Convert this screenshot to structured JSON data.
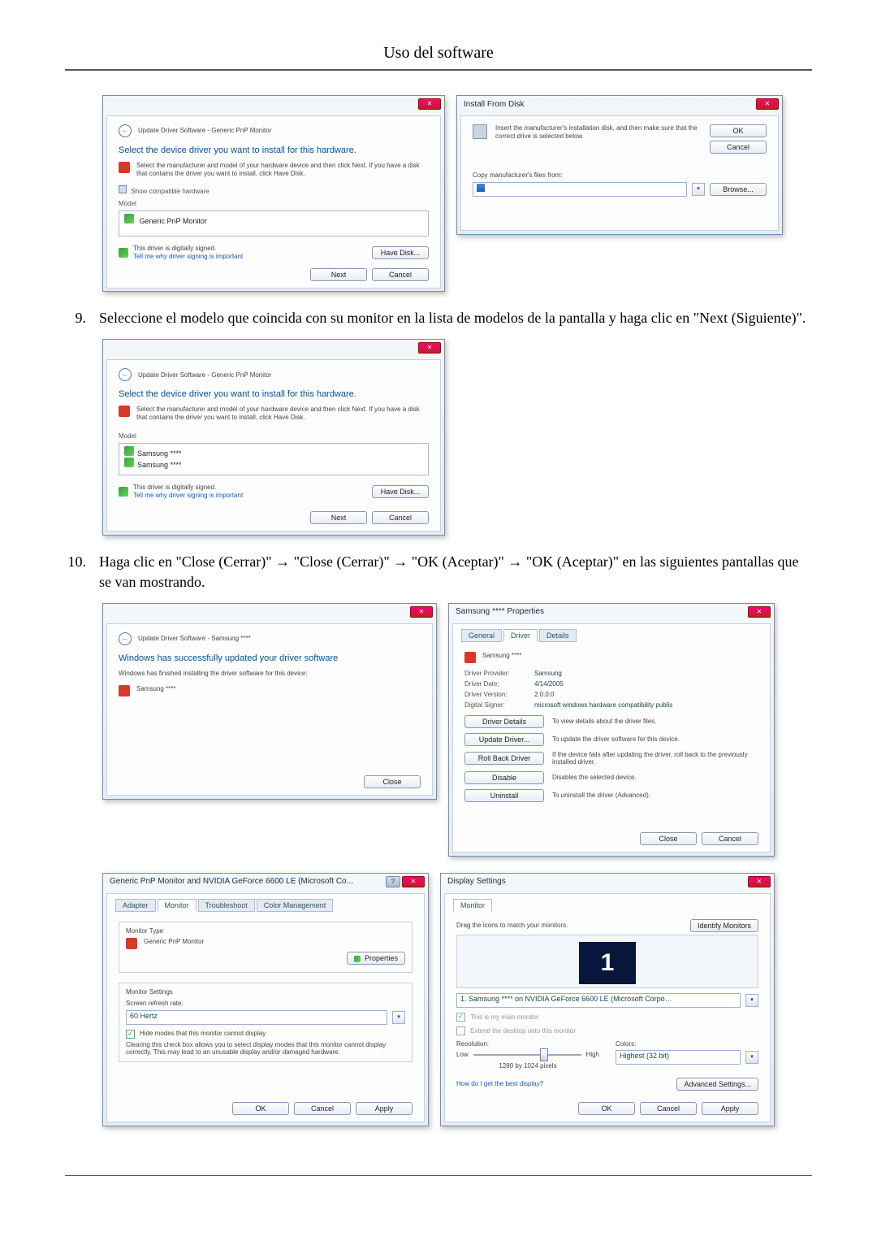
{
  "page": {
    "header": "Uso del software"
  },
  "step9": {
    "num": "9.",
    "text": "Seleccione el modelo que coincida con su monitor en la lista de modelos de la pantalla y haga clic en \"Next (Siguiente)\"."
  },
  "step10": {
    "num": "10.",
    "text": "Haga clic en \"Close (Cerrar)\" → \"Close (Cerrar)\" → \"OK (Aceptar)\" → \"OK (Aceptar)\" en las siguientes pantallas que se van mostrando."
  },
  "win_update1": {
    "title": "Update Driver Software - Generic PnP Monitor",
    "heading": "Select the device driver you want to install for this hardware.",
    "note": "Select the manufacturer and model of your hardware device and then click Next. If you have a disk that contains the driver you want to install, click Have Disk.",
    "show_compat": "Show compatible hardware",
    "model_label": "Model",
    "model_item": "Generic PnP Monitor",
    "signed": "This driver is digitally signed.",
    "tell_me": "Tell me why driver signing is important",
    "have_disk": "Have Disk...",
    "next": "Next",
    "cancel": "Cancel"
  },
  "win_install": {
    "title": "Install From Disk",
    "text": "Insert the manufacturer's installation disk, and then make sure that the correct drive is selected below.",
    "copy_label": "Copy manufacturer's files from:",
    "ok": "OK",
    "cancel": "Cancel",
    "browse": "Browse..."
  },
  "win_update2": {
    "title": "Update Driver Software - Generic PnP Monitor",
    "heading": "Select the device driver you want to install for this hardware.",
    "note": "Select the manufacturer and model of your hardware device and then click Next. If you have a disk that contains the driver you want to install, click Have Disk.",
    "model_label": "Model",
    "model_item_a": "Samsung ****",
    "model_item_b": "Samsung ****",
    "signed": "This driver is digitally signed.",
    "tell_me": "Tell me why driver signing is important",
    "have_disk": "Have Disk...",
    "next": "Next",
    "cancel": "Cancel"
  },
  "win_done": {
    "title": "Update Driver Software - Samsung ****",
    "heading": "Windows has successfully updated your driver software",
    "note": "Windows has finished installing the driver software for this device:",
    "device": "Samsung ****",
    "close": "Close"
  },
  "win_props": {
    "title": "Samsung **** Properties",
    "tab_general": "General",
    "tab_driver": "Driver",
    "tab_details": "Details",
    "device": "Samsung ****",
    "provider_k": "Driver Provider:",
    "provider_v": "Samsung",
    "date_k": "Driver Date:",
    "date_v": "4/14/2005",
    "version_k": "Driver Version:",
    "version_v": "2.0.0.0",
    "signer_k": "Digital Signer:",
    "signer_v": "microsoft windows hardware compatibility publis",
    "btn_details": "Driver Details",
    "btn_details_txt": "To view details about the driver files.",
    "btn_update": "Update Driver...",
    "btn_update_txt": "To update the driver software for this device.",
    "btn_roll": "Roll Back Driver",
    "btn_roll_txt": "If the device fails after updating the driver, roll back to the previously installed driver.",
    "btn_disable": "Disable",
    "btn_disable_txt": "Disables the selected device.",
    "btn_uninst": "Uninstall",
    "btn_uninst_txt": "To uninstall the driver (Advanced).",
    "close": "Close",
    "cancel": "Cancel"
  },
  "win_monitor": {
    "title": "Generic PnP Monitor and NVIDIA GeForce 6600 LE (Microsoft Co...",
    "tab_adapter": "Adapter",
    "tab_monitor": "Monitor",
    "tab_trouble": "Troubleshoot",
    "tab_color": "Color Management",
    "montype_label": "Monitor Type",
    "montype_value": "Generic PnP Monitor",
    "properties": "Properties",
    "settings_label": "Monitor Settings",
    "refresh_label": "Screen refresh rate:",
    "refresh_value": "60 Hertz",
    "hide_modes": "Hide modes that this monitor cannot display",
    "hide_note": "Clearing this check box allows you to select display modes that this monitor cannot display correctly. This may lead to an unusable display and/or damaged hardware.",
    "ok": "OK",
    "cancel": "Cancel",
    "apply": "Apply"
  },
  "win_display": {
    "title": "Display Settings",
    "tab_monitor": "Monitor",
    "drag_text": "Drag the icons to match your monitors.",
    "identify": "Identify Monitors",
    "monitor_num": "1",
    "monitor_sel": "1. Samsung **** on NVIDIA GeForce 6600 LE (Microsoft Corpo…",
    "main_monitor": "This is my main monitor",
    "extend": "Extend the desktop onto this monitor",
    "res_label": "Resolution:",
    "low": "Low",
    "high": "High",
    "res_value": "1280 by 1024 pixels",
    "colors_label": "Colors:",
    "colors_value": "Highest (32 bit)",
    "best_display": "How do I get the best display?",
    "advanced": "Advanced Settings...",
    "ok": "OK",
    "cancel": "Cancel",
    "apply": "Apply"
  }
}
